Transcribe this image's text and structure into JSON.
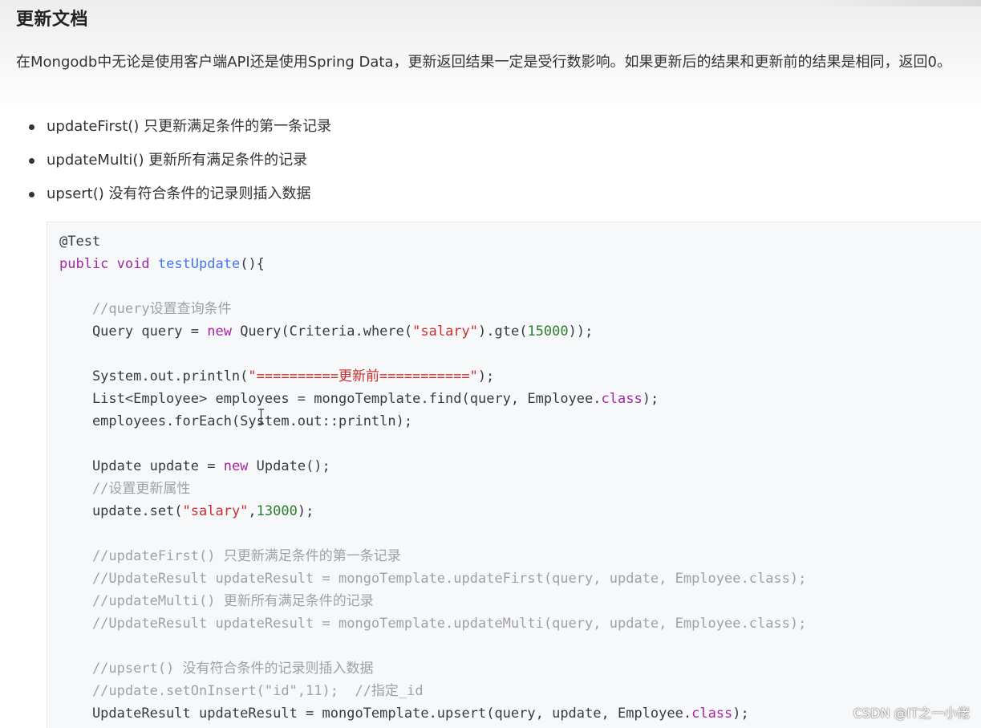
{
  "document": {
    "title": "更新文档",
    "intro": "在Mongodb中无论是使用客户端API还是使用Spring Data，更新返回结果一定是受行数影响。如果更新后的结果和更新前的结果是相同，返回0。",
    "bullets": [
      "updateFirst() 只更新满足条件的第一条记录",
      "updateMulti() 更新所有满足条件的记录",
      "upsert() 没有符合条件的记录则插入数据"
    ]
  },
  "code": {
    "language": "java",
    "lines": [
      [
        {
          "t": "@Test",
          "c": "plain"
        }
      ],
      [
        {
          "t": "public ",
          "c": "kw"
        },
        {
          "t": "void ",
          "c": "kw"
        },
        {
          "t": "testUpdate",
          "c": "fn"
        },
        {
          "t": "(){",
          "c": "plain"
        }
      ],
      [],
      [
        {
          "t": "    //query设置查询条件",
          "c": "cmt"
        }
      ],
      [
        {
          "t": "    Query query = ",
          "c": "plain"
        },
        {
          "t": "new ",
          "c": "kw"
        },
        {
          "t": "Query(Criteria.where(",
          "c": "plain"
        },
        {
          "t": "\"salary\"",
          "c": "str"
        },
        {
          "t": ").gte(",
          "c": "plain"
        },
        {
          "t": "15000",
          "c": "num"
        },
        {
          "t": "));",
          "c": "plain"
        }
      ],
      [],
      [
        {
          "t": "    System.out.println(",
          "c": "plain"
        },
        {
          "t": "\"==========更新前===========\"",
          "c": "str"
        },
        {
          "t": ");",
          "c": "plain"
        }
      ],
      [
        {
          "t": "    List<Employee> employees = mongoTemplate.find(query, Employee.",
          "c": "plain"
        },
        {
          "t": "class",
          "c": "kw"
        },
        {
          "t": ");",
          "c": "plain"
        }
      ],
      [
        {
          "t": "    employees.forEach(System.out::println);",
          "c": "plain"
        }
      ],
      [],
      [
        {
          "t": "    Update update = ",
          "c": "plain"
        },
        {
          "t": "new ",
          "c": "kw"
        },
        {
          "t": "Update();",
          "c": "plain"
        }
      ],
      [
        {
          "t": "    //设置更新属性",
          "c": "cmt"
        }
      ],
      [
        {
          "t": "    update.set(",
          "c": "plain"
        },
        {
          "t": "\"salary\"",
          "c": "str"
        },
        {
          "t": ",",
          "c": "plain"
        },
        {
          "t": "13000",
          "c": "num"
        },
        {
          "t": ");",
          "c": "plain"
        }
      ],
      [],
      [
        {
          "t": "    //updateFirst() 只更新满足条件的第一条记录",
          "c": "cmt"
        }
      ],
      [
        {
          "t": "    //UpdateResult updateResult = mongoTemplate.updateFirst(query, update, Employee.class);",
          "c": "cmt"
        }
      ],
      [
        {
          "t": "    //updateMulti() 更新所有满足条件的记录",
          "c": "cmt"
        }
      ],
      [
        {
          "t": "    //UpdateResult updateResult = mongoTemplate.updateMulti(query, update, Employee.class);",
          "c": "cmt"
        }
      ],
      [],
      [
        {
          "t": "    //upsert() 没有符合条件的记录则插入数据",
          "c": "cmt"
        }
      ],
      [
        {
          "t": "    //update.setOnInsert(\"id\",11);  //指定_id",
          "c": "cmt"
        }
      ],
      [
        {
          "t": "    UpdateResult updateResult = mongoTemplate.upsert(query, update, Employee.",
          "c": "plain"
        },
        {
          "t": "class",
          "c": "kw"
        },
        {
          "t": ");",
          "c": "plain"
        }
      ]
    ]
  },
  "watermark": "CSDN @IT之一小佬",
  "colors": {
    "keyword": "#a626a4",
    "function": "#4078f2",
    "string": "#c9302c",
    "number": "#2e7d32",
    "comment": "#a0a1a7",
    "code_background": "#f6f8fa"
  }
}
